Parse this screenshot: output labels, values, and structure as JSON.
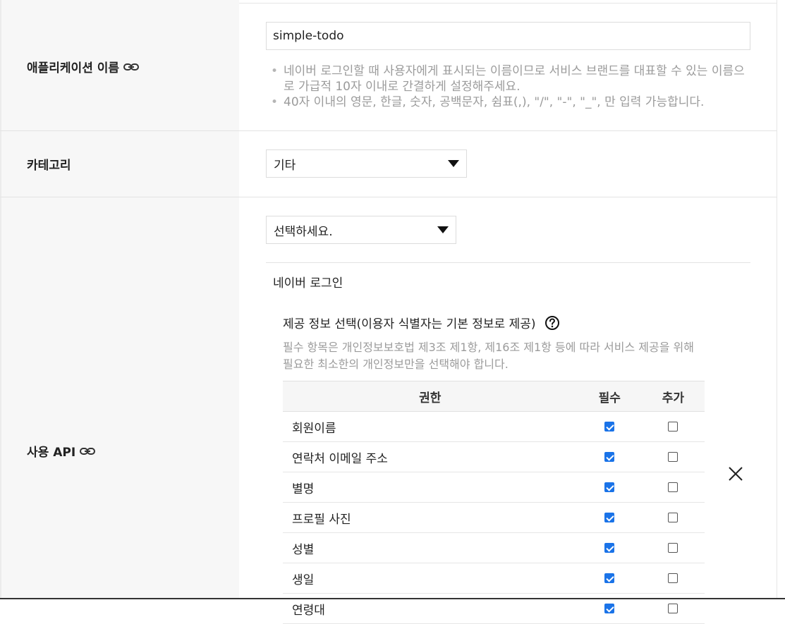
{
  "app_name_row": {
    "label": "애플리케이션 이름",
    "input_value": "simple-todo",
    "help": [
      "네이버 로그인할 때 사용자에게 표시되는 이름이므로 서비스 브랜드를 대표할 수 있는 이름으로 가급적 10자 이내로 간결하게 설정해주세요.",
      "40자 이내의 영문, 한글, 숫자, 공백문자, 쉼표(,), \"/\", \"-\", \"_\", 만 입력 가능합니다."
    ]
  },
  "category_row": {
    "label": "카테고리",
    "selected": "기타"
  },
  "api_row": {
    "label": "사용 API",
    "select_placeholder": "선택하세요.",
    "api_title": "네이버 로그인",
    "provide_title": "제공 정보 선택(이용자 식별자는 기본 정보로 제공)",
    "provide_desc": "필수 항목은 개인정보보호법 제3조 제1항, 제16조 제1항 등에 따라 서비스 제공을 위해 필요한 최소한의 개인정보만을 선택해야 합니다.",
    "table": {
      "headers": [
        "권한",
        "필수",
        "추가"
      ],
      "rows": [
        {
          "name": "회원이름",
          "required": true,
          "additional": false
        },
        {
          "name": "연락처 이메일 주소",
          "required": true,
          "additional": false
        },
        {
          "name": "별명",
          "required": true,
          "additional": false
        },
        {
          "name": "프로필 사진",
          "required": true,
          "additional": false
        },
        {
          "name": "성별",
          "required": true,
          "additional": false
        },
        {
          "name": "생일",
          "required": true,
          "additional": false
        },
        {
          "name": "연령대",
          "required": true,
          "additional": false
        }
      ]
    }
  },
  "icons": {
    "link": "link-icon",
    "help": "question-circle-icon",
    "close": "close-icon",
    "dropdown": "caret-down-icon"
  },
  "colors": {
    "checkbox_checked": "#1a73e8",
    "label_background": "#f7f7f7",
    "help_text": "#9b9b9b"
  }
}
